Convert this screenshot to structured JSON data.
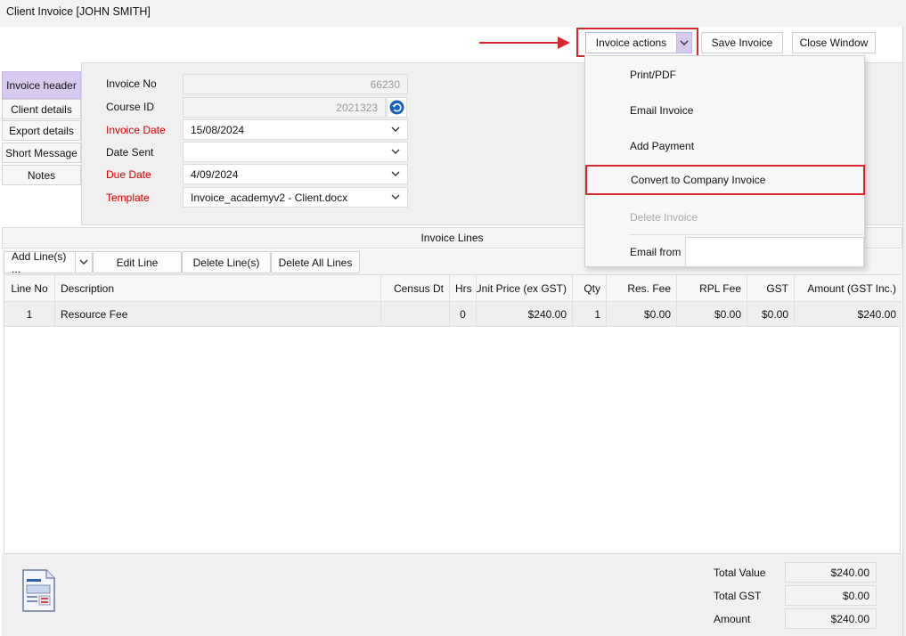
{
  "window": {
    "title": "Client Invoice [JOHN SMITH]"
  },
  "toolbar": {
    "invoice_actions_label": "Invoice actions",
    "save_label": "Save Invoice",
    "close_label": "Close Window"
  },
  "menu": {
    "items": [
      {
        "label": "Print/PDF",
        "enabled": true
      },
      {
        "label": "Email Invoice",
        "enabled": true
      },
      {
        "label": "Add Payment",
        "enabled": true
      },
      {
        "label": "Convert to Company Invoice",
        "enabled": true,
        "highlighted": true
      },
      {
        "label": "Delete Invoice",
        "enabled": false
      }
    ],
    "email_from_label": "Email from",
    "email_from_value": ""
  },
  "tabs": [
    {
      "label": "Invoice header",
      "active": true
    },
    {
      "label": "Client details"
    },
    {
      "label": "Export details"
    },
    {
      "label": "Short Message"
    },
    {
      "label": "Notes"
    }
  ],
  "header": {
    "invoice_no": {
      "label": "Invoice No",
      "value": "66230"
    },
    "course_id": {
      "label": "Course ID",
      "value": "2021323"
    },
    "invoice_date": {
      "label": "Invoice Date",
      "value": "15/08/2024"
    },
    "date_sent": {
      "label": "Date Sent",
      "value": ""
    },
    "due_date": {
      "label": "Due Date",
      "value": "4/09/2024"
    },
    "template": {
      "label": "Template",
      "value": "Invoice_academyv2 - Client.docx"
    }
  },
  "lines": {
    "section_title": "Invoice Lines",
    "buttons": {
      "add": "Add Line(s) ...",
      "edit": "Edit Line",
      "delete": "Delete Line(s)",
      "delete_all": "Delete All Lines"
    },
    "columns": [
      "Line No",
      "Description",
      "Census Dt",
      "Hrs",
      "Unit Price (ex GST)",
      "Qty",
      "Res. Fee",
      "RPL Fee",
      "GST",
      "Amount (GST Inc.)"
    ],
    "rows": [
      [
        "1",
        "Resource Fee",
        "",
        "0",
        "$240.00",
        "1",
        "$0.00",
        "$0.00",
        "$0.00",
        "$240.00"
      ]
    ]
  },
  "totals": {
    "total_value": {
      "label": "Total Value",
      "value": "$240.00"
    },
    "total_gst": {
      "label": "Total GST",
      "value": "$0.00"
    },
    "amount": {
      "label": "Amount",
      "value": "$240.00"
    }
  },
  "colors": {
    "accent_purple": "#d8c9ef",
    "annotation_red": "#d7282f",
    "required_label_red": "#d40000"
  },
  "icons": [
    "chevron-down-icon",
    "refresh-icon",
    "invoice-document-icon",
    "red-arrow-annotation"
  ]
}
